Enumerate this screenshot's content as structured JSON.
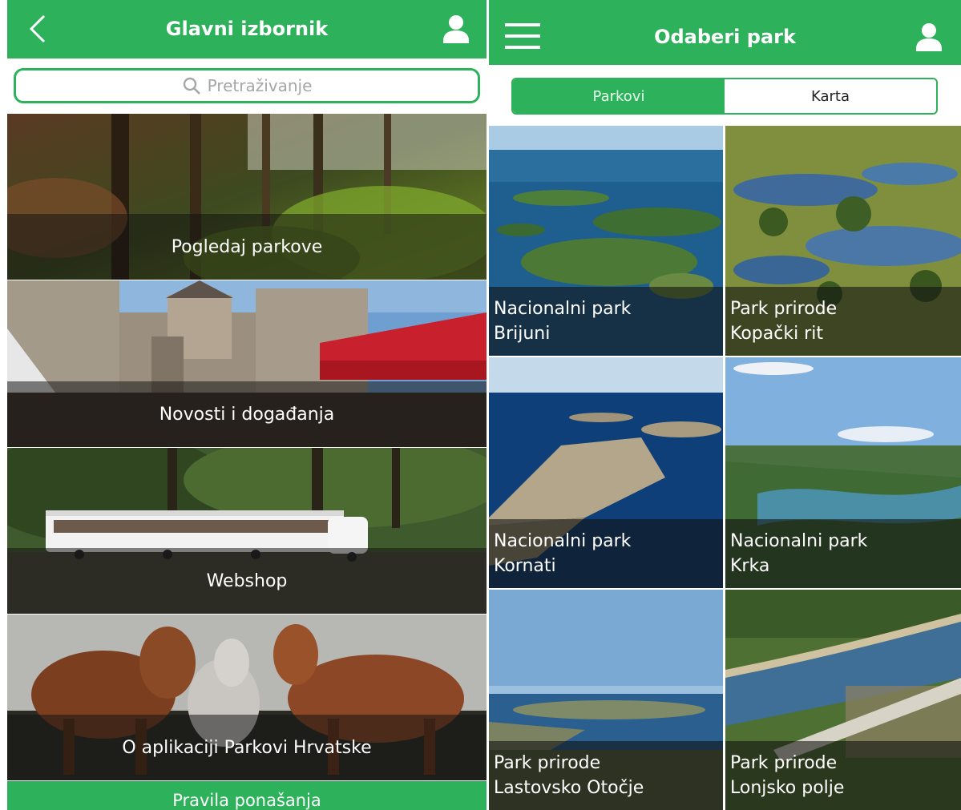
{
  "left": {
    "header": {
      "title": "Glavni izbornik",
      "back_icon": "chevron-left-icon",
      "user_icon": "user-icon"
    },
    "search": {
      "placeholder": "Pretraživanje",
      "icon": "search-icon"
    },
    "menu_items": [
      {
        "label": "Pogledaj parkove"
      },
      {
        "label": "Novosti i događanja"
      },
      {
        "label": "Webshop"
      },
      {
        "label": "O aplikaciji Parkovi Hrvatske"
      }
    ],
    "footer": {
      "label": "Pravila ponašanja"
    }
  },
  "right": {
    "header": {
      "title": "Odaberi park",
      "menu_icon": "hamburger-menu-icon",
      "user_icon": "user-icon"
    },
    "tabs": [
      {
        "label": "Parkovi",
        "active": true
      },
      {
        "label": "Karta",
        "active": false
      }
    ],
    "parks": [
      {
        "line1": "Nacionalni park",
        "line2": "Brijuni"
      },
      {
        "line1": "Park prirode",
        "line2": "Kopački rit"
      },
      {
        "line1": "Nacionalni park",
        "line2": "Kornati"
      },
      {
        "line1": "Nacionalni park",
        "line2": "Krka"
      },
      {
        "line1": "Park prirode",
        "line2": "Lastovsko Otočje"
      },
      {
        "line1": "Park prirode",
        "line2": "Lonjsko polje"
      }
    ]
  },
  "colors": {
    "brand_green": "#2db25b",
    "header_text": "#ffffff",
    "search_placeholder": "#a6a6a6"
  }
}
